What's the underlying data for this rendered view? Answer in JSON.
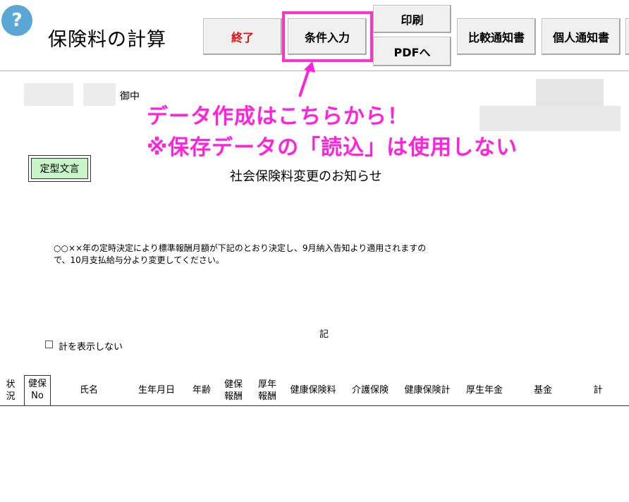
{
  "header": {
    "help_glyph": "?",
    "title": "保険料の計算"
  },
  "toolbar": {
    "exit": "終了",
    "condition_input": "条件入力",
    "print": "印刷",
    "pdf": "PDFへ",
    "comparison_notice": "比較通知書",
    "individual_notice": "個人通知書"
  },
  "document": {
    "addressee_suffix": "御中",
    "template_button": "定型文言",
    "notice_title": "社会保険料変更のお知らせ",
    "body_line1": "○○××年の定時決定により標準報酬月額が下記のとおり決定し、9月納入告知より適用されますの",
    "body_line2": "で、10月支払給与分より変更してください。",
    "ki_mark": "記",
    "hide_total_label": "計を表示しない"
  },
  "annotation": {
    "line1": "データ作成はこちらから！",
    "line2": "※保存データの「読込」は使用しない",
    "color": "#ff22dd"
  },
  "table": {
    "headers": {
      "status_1": "状",
      "status_2": "況",
      "health_no_1": "健保",
      "health_no_2": "No",
      "name": "氏名",
      "birthdate": "生年月日",
      "age": "年齢",
      "health_rem_1": "健保",
      "health_rem_2": "報酬",
      "pension_rem_1": "厚年",
      "pension_rem_2": "報酬",
      "health_ins": "健康保険料",
      "care_ins": "介護保険",
      "health_total": "健康保険計",
      "pension": "厚生年金",
      "fund": "基金",
      "total": "計"
    }
  }
}
